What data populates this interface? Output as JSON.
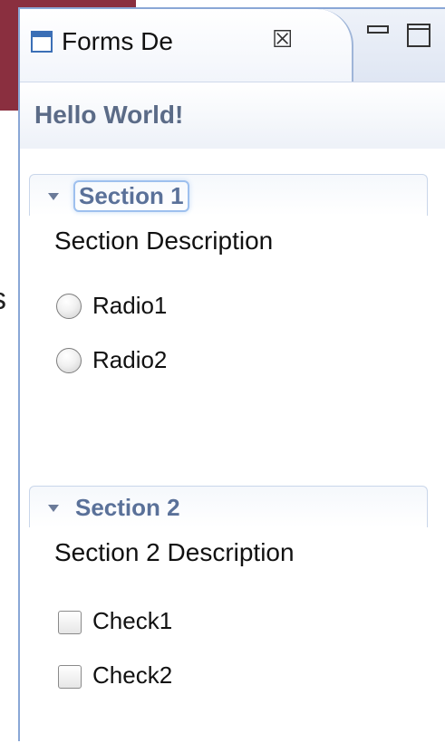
{
  "view": {
    "tab_title": "Forms De",
    "close_glyph": "☒"
  },
  "header": {
    "title": "Hello World!"
  },
  "sections": [
    {
      "title": "Section 1",
      "description": "Section Description",
      "items": [
        {
          "type": "radio",
          "label": "Radio1",
          "checked": false
        },
        {
          "type": "radio",
          "label": "Radio2",
          "checked": false
        }
      ]
    },
    {
      "title": "Section 2",
      "description": "Section 2 Description",
      "items": [
        {
          "type": "checkbox",
          "label": "Check1",
          "checked": false
        },
        {
          "type": "checkbox",
          "label": "Check2",
          "checked": false
        }
      ]
    }
  ],
  "background": {
    "partial_text": "s"
  },
  "colors": {
    "maroon": "#8a2f3f",
    "view_border": "#8aa7d6",
    "section_title": "#5a7199",
    "header_title": "#5b6b87"
  }
}
